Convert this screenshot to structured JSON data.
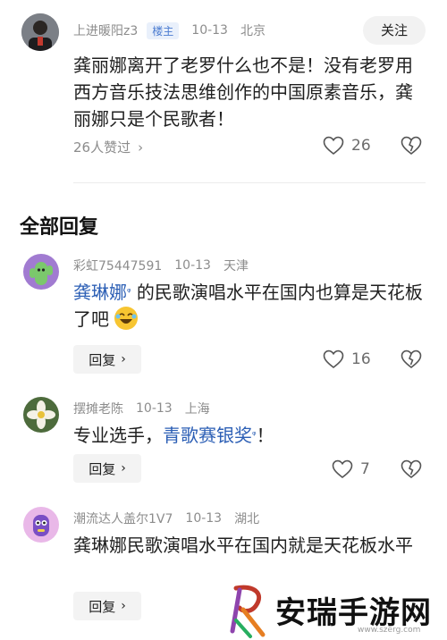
{
  "op": {
    "username": "上进暖阳z3",
    "badge": "楼主",
    "date": "10-13",
    "location": "北京",
    "follow_label": "关注",
    "text": "龚丽娜离开了老罗什么也不是！没有老罗用西方音乐技法思维创作的中国原素音乐，龚丽娜只是个民歌者！",
    "likes_summary": "26人赞过",
    "like_count": "26"
  },
  "section_title": "全部回复",
  "comments": [
    {
      "username": "彩虹75447591",
      "date": "10-13",
      "location": "天津",
      "mention": "龚琳娜",
      "text_after": " 的民歌演唱水平在国内也算是天花板了吧",
      "reply_label": "回复",
      "like_count": "16"
    },
    {
      "username": "摆摊老陈",
      "date": "10-13",
      "location": "上海",
      "text_before": "专业选手，",
      "mention": "青歌赛银奖",
      "text_after": "！",
      "reply_label": "回复",
      "like_count": "7"
    },
    {
      "username": "潮流达人盖尔1V7",
      "date": "10-13",
      "location": "湖北",
      "text": "龚琳娜民歌演唱水平在国内就是天花板水平",
      "reply_label": "回复"
    }
  ],
  "watermark": {
    "brand": "安瑞手游网",
    "url": "www.szerg.com"
  },
  "colors": {
    "link": "#2c5fb5",
    "muted": "#8c8c8c",
    "badge_bg": "#e9f0fb",
    "badge_text": "#4a7bd0"
  }
}
